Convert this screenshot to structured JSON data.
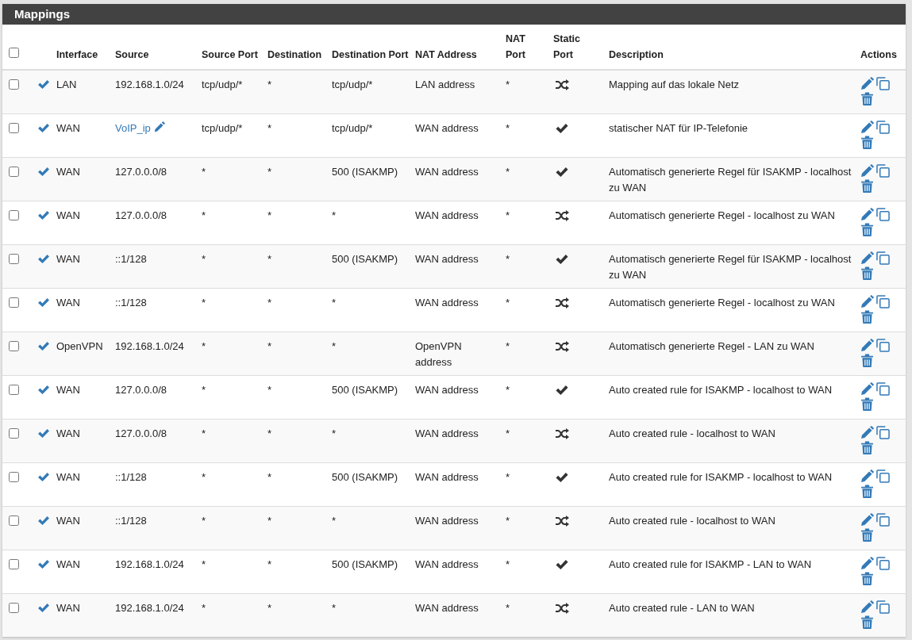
{
  "panel": {
    "title": "Mappings"
  },
  "columns": [
    "Interface",
    "Source",
    "Source Port",
    "Destination",
    "Destination Port",
    "NAT Address",
    "NAT Port",
    "Static Port",
    "Description",
    "Actions"
  ],
  "header_checkbox": {
    "checked": false
  },
  "rows": [
    {
      "checked": false,
      "enabled": true,
      "interface": "LAN",
      "source": "192.168.1.0/24",
      "source_link": false,
      "source_port": "tcp/udp/*",
      "destination": "*",
      "destination_port": "tcp/udp/*",
      "nat_address": "LAN address",
      "nat_port": "*",
      "static_port": false,
      "description": "Mapping auf das lokale Netz"
    },
    {
      "checked": false,
      "enabled": true,
      "interface": "WAN",
      "source": "VoIP_ip",
      "source_link": true,
      "source_port": "tcp/udp/*",
      "destination": "*",
      "destination_port": "tcp/udp/*",
      "nat_address": "WAN address",
      "nat_port": "*",
      "static_port": true,
      "description": "statischer NAT für IP-Telefonie"
    },
    {
      "checked": false,
      "enabled": true,
      "interface": "WAN",
      "source": "127.0.0.0/8",
      "source_link": false,
      "source_port": "*",
      "destination": "*",
      "destination_port": "500 (ISAKMP)",
      "nat_address": "WAN address",
      "nat_port": "*",
      "static_port": true,
      "description": "Automatisch generierte Regel für ISAKMP - localhost zu WAN"
    },
    {
      "checked": false,
      "enabled": true,
      "interface": "WAN",
      "source": "127.0.0.0/8",
      "source_link": false,
      "source_port": "*",
      "destination": "*",
      "destination_port": "*",
      "nat_address": "WAN address",
      "nat_port": "*",
      "static_port": false,
      "description": "Automatisch generierte Regel - localhost zu WAN"
    },
    {
      "checked": false,
      "enabled": true,
      "interface": "WAN",
      "source": "::1/128",
      "source_link": false,
      "source_port": "*",
      "destination": "*",
      "destination_port": "500 (ISAKMP)",
      "nat_address": "WAN address",
      "nat_port": "*",
      "static_port": true,
      "description": "Automatisch generierte Regel für ISAKMP - localhost zu WAN"
    },
    {
      "checked": false,
      "enabled": true,
      "interface": "WAN",
      "source": "::1/128",
      "source_link": false,
      "source_port": "*",
      "destination": "*",
      "destination_port": "*",
      "nat_address": "WAN address",
      "nat_port": "*",
      "static_port": false,
      "description": "Automatisch generierte Regel - localhost zu WAN"
    },
    {
      "checked": false,
      "enabled": true,
      "interface": "OpenVPN",
      "source": "192.168.1.0/24",
      "source_link": false,
      "source_port": "*",
      "destination": "*",
      "destination_port": "*",
      "nat_address": "OpenVPN address",
      "nat_port": "*",
      "static_port": false,
      "description": "Automatisch generierte Regel - LAN zu WAN"
    },
    {
      "checked": false,
      "enabled": true,
      "interface": "WAN",
      "source": "127.0.0.0/8",
      "source_link": false,
      "source_port": "*",
      "destination": "*",
      "destination_port": "500 (ISAKMP)",
      "nat_address": "WAN address",
      "nat_port": "*",
      "static_port": true,
      "description": "Auto created rule for ISAKMP - localhost to WAN"
    },
    {
      "checked": false,
      "enabled": true,
      "interface": "WAN",
      "source": "127.0.0.0/8",
      "source_link": false,
      "source_port": "*",
      "destination": "*",
      "destination_port": "*",
      "nat_address": "WAN address",
      "nat_port": "*",
      "static_port": false,
      "description": "Auto created rule - localhost to WAN"
    },
    {
      "checked": false,
      "enabled": true,
      "interface": "WAN",
      "source": "::1/128",
      "source_link": false,
      "source_port": "*",
      "destination": "*",
      "destination_port": "500 (ISAKMP)",
      "nat_address": "WAN address",
      "nat_port": "*",
      "static_port": true,
      "description": "Auto created rule for ISAKMP - localhost to WAN"
    },
    {
      "checked": false,
      "enabled": true,
      "interface": "WAN",
      "source": "::1/128",
      "source_link": false,
      "source_port": "*",
      "destination": "*",
      "destination_port": "*",
      "nat_address": "WAN address",
      "nat_port": "*",
      "static_port": false,
      "description": "Auto created rule - localhost to WAN"
    },
    {
      "checked": false,
      "enabled": true,
      "interface": "WAN",
      "source": "192.168.1.0/24",
      "source_link": false,
      "source_port": "*",
      "destination": "*",
      "destination_port": "500 (ISAKMP)",
      "nat_address": "WAN address",
      "nat_port": "*",
      "static_port": true,
      "description": "Auto created rule for ISAKMP - LAN to WAN"
    },
    {
      "checked": false,
      "enabled": true,
      "interface": "WAN",
      "source": "192.168.1.0/24",
      "source_link": false,
      "source_port": "*",
      "destination": "*",
      "destination_port": "*",
      "nat_address": "WAN address",
      "nat_port": "*",
      "static_port": false,
      "description": "Auto created rule - LAN to WAN"
    }
  ]
}
